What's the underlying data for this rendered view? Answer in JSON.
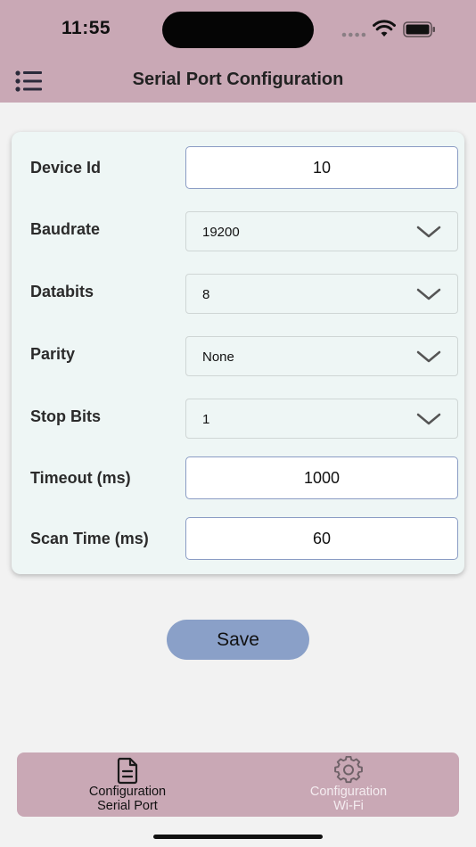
{
  "status_bar": {
    "time": "11:55"
  },
  "header": {
    "title": "Serial Port Configuration"
  },
  "form": {
    "device_id": {
      "label": "Device Id",
      "value": "10"
    },
    "baudrate": {
      "label": "Baudrate",
      "value": "19200"
    },
    "databits": {
      "label": "Databits",
      "value": "8"
    },
    "parity": {
      "label": "Parity",
      "value": "None"
    },
    "stop_bits": {
      "label": "Stop Bits",
      "value": "1"
    },
    "timeout": {
      "label": "Timeout (ms)",
      "value": "1000"
    },
    "scan_time": {
      "label": "Scan Time (ms)",
      "value": "60"
    }
  },
  "save_label": "Save",
  "tabs": [
    {
      "label_line1": "Configuration",
      "label_line2": "Serial Port",
      "icon": "document-icon",
      "active": true
    },
    {
      "label_line1": "Configuration",
      "label_line2": "Wi-Fi",
      "icon": "gear-icon",
      "active": false
    }
  ],
  "colors": {
    "header_bg": "#c9a8b5",
    "card_bg": "#eef6f5",
    "save_button": "#8aa0c8",
    "tab_inactive_text": "#f4ecf0"
  }
}
